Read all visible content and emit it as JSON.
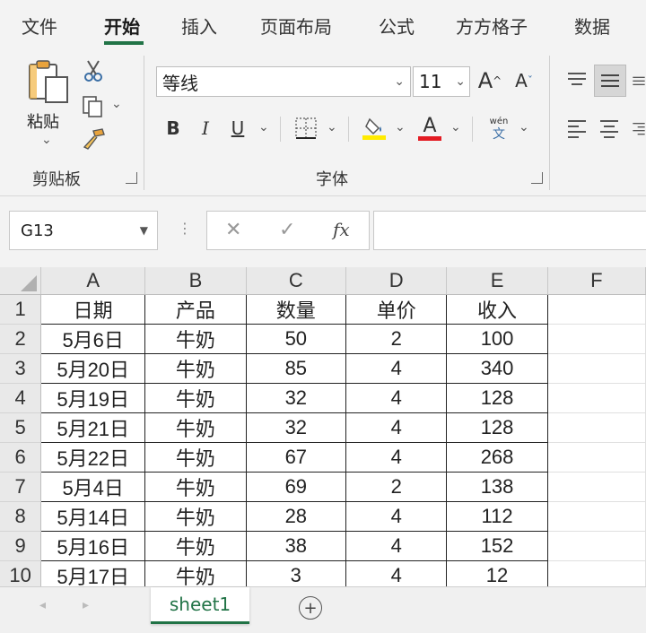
{
  "menu": {
    "tabs": [
      "文件",
      "开始",
      "插入",
      "页面布局",
      "公式",
      "方方格子",
      "数据"
    ],
    "active": "开始"
  },
  "ribbon": {
    "clipboard": {
      "paste_label": "粘贴",
      "group_label": "剪贴板"
    },
    "font": {
      "font_name": "等线",
      "font_size": "11",
      "bold": "B",
      "italic": "I",
      "underline": "U",
      "font_color_letter": "A",
      "phonetic_top": "wén",
      "phonetic_bottom": "文",
      "group_label": "字体",
      "grow": "A",
      "shrink": "A"
    },
    "colors": {
      "highlight": "#ffeb00",
      "font_color": "#e31b23",
      "accent": "#217346"
    }
  },
  "formula_bar": {
    "name_box": "G13",
    "cancel": "✕",
    "enter": "✓",
    "fx": "fx"
  },
  "grid": {
    "columns": [
      "A",
      "B",
      "C",
      "D",
      "E",
      "F"
    ],
    "header_row": [
      "日期",
      "产品",
      "数量",
      "单价",
      "收入"
    ],
    "rows": [
      [
        "5月6日",
        "牛奶",
        "50",
        "2",
        "100"
      ],
      [
        "5月20日",
        "牛奶",
        "85",
        "4",
        "340"
      ],
      [
        "5月19日",
        "牛奶",
        "32",
        "4",
        "128"
      ],
      [
        "5月21日",
        "牛奶",
        "32",
        "4",
        "128"
      ],
      [
        "5月22日",
        "牛奶",
        "67",
        "4",
        "268"
      ],
      [
        "5月4日",
        "牛奶",
        "69",
        "2",
        "138"
      ],
      [
        "5月14日",
        "牛奶",
        "28",
        "4",
        "112"
      ],
      [
        "5月16日",
        "牛奶",
        "38",
        "4",
        "152"
      ],
      [
        "5月17日",
        "牛奶",
        "3",
        "4",
        "12"
      ]
    ],
    "row_numbers": [
      "1",
      "2",
      "3",
      "4",
      "5",
      "6",
      "7",
      "8",
      "9",
      "10"
    ]
  },
  "sheets": {
    "tabs": [
      "sheet1"
    ],
    "add": "+"
  }
}
